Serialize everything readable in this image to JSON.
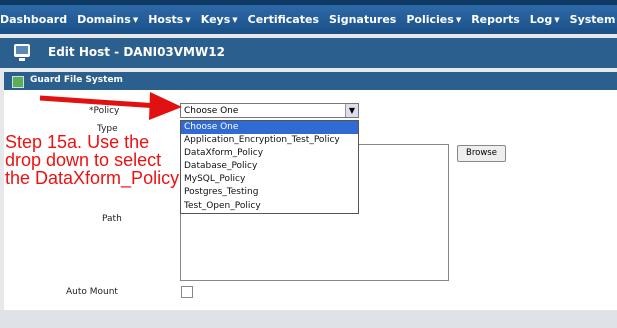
{
  "nav": {
    "items": [
      {
        "label": "Dashboard",
        "caret": false
      },
      {
        "label": "Domains",
        "caret": true
      },
      {
        "label": "Hosts",
        "caret": true
      },
      {
        "label": "Keys",
        "caret": true
      },
      {
        "label": "Certificates",
        "caret": false
      },
      {
        "label": "Signatures",
        "caret": false
      },
      {
        "label": "Policies",
        "caret": true
      },
      {
        "label": "Reports",
        "caret": false
      },
      {
        "label": "Log",
        "caret": true
      },
      {
        "label": "System",
        "caret": true
      }
    ]
  },
  "page": {
    "title": "Edit Host - DANI03VMW12"
  },
  "section": {
    "title": "Guard File System"
  },
  "form": {
    "policy_label": "*Policy",
    "type_label": "Type",
    "path_label": "Path",
    "auto_mount_label": "Auto Mount",
    "policy_selected": "Choose One",
    "browse_label": "Browse",
    "dropdown_options": [
      "Choose One",
      "Application_Encryption_Test_Policy",
      "DataXform_Policy",
      "Database_Policy",
      "MySQL_Policy",
      "Postgres_Testing",
      "Test_Open_Policy"
    ]
  },
  "annotation": {
    "text": "Step 15a. Use the drop down to select the DataXform_Policy"
  },
  "colors": {
    "annotation": "#e11111",
    "selected_option": "#2f6bd3",
    "header": "#2b5f8e"
  }
}
